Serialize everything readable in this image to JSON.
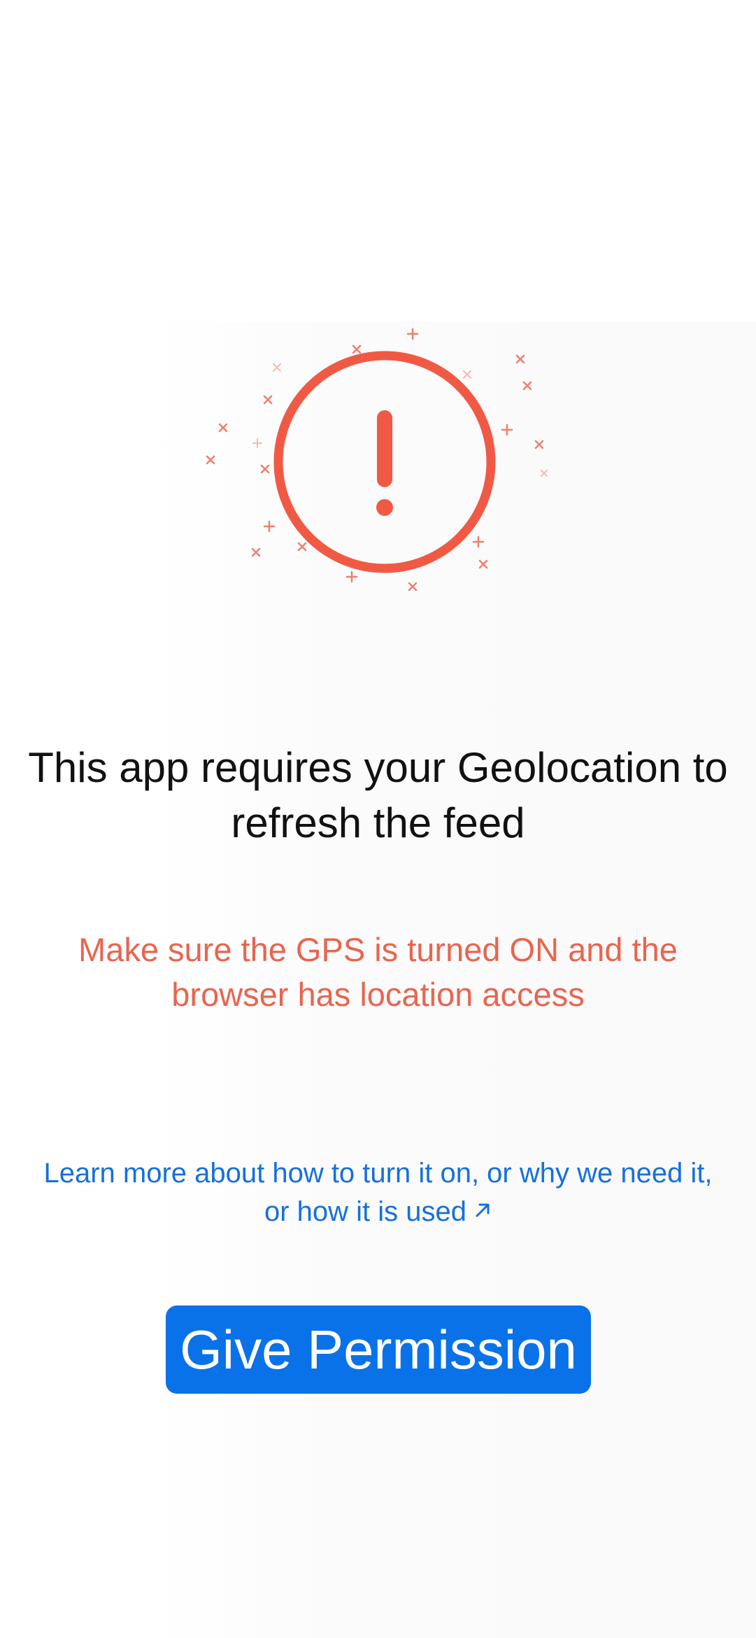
{
  "colors": {
    "alert_red": "#f05a44",
    "accent_blue": "#0a72e8",
    "link_blue": "#1570dc"
  },
  "illustration": {
    "icon": "alert-circle-icon"
  },
  "message": {
    "heading": "This app requires your Geolocation to refresh the feed",
    "warning": "Make sure the GPS is turned ON and the browser has location access"
  },
  "learn_more": {
    "label": "Learn more about how to turn it on, or why we need it, or how it is used",
    "icon": "external-link-arrow-icon"
  },
  "cta": {
    "label": "Give Permission"
  }
}
